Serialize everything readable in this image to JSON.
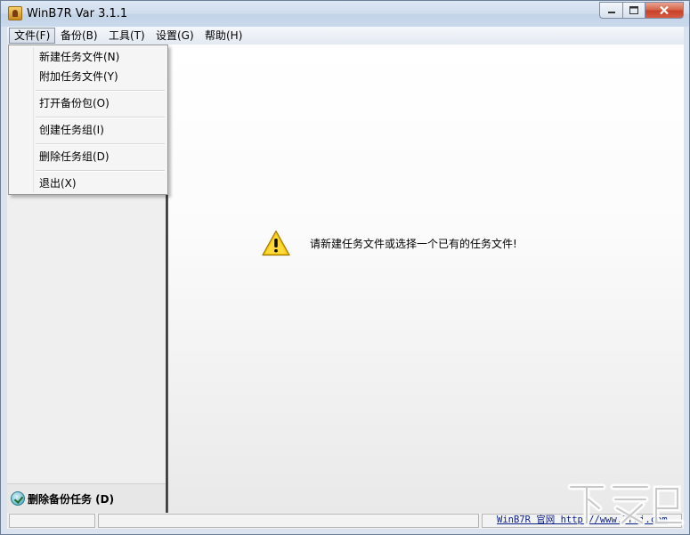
{
  "window": {
    "title": "WinB7R Var 3.1.1"
  },
  "menu": [
    {
      "label": "文件(F)"
    },
    {
      "label": "备份(B)"
    },
    {
      "label": "工具(T)"
    },
    {
      "label": "设置(G)"
    },
    {
      "label": "帮助(H)"
    }
  ],
  "file_menu": {
    "items": [
      {
        "label": "新建任务文件(N)"
      },
      {
        "label": "附加任务文件(Y)"
      },
      {
        "label": "打开备份包(O)"
      },
      {
        "label": "创建任务组(I)"
      },
      {
        "label": "删除任务组(D)"
      },
      {
        "label": "退出(X)"
      }
    ]
  },
  "left_pane": {
    "delete_task_label": "删除备份任务 (D)"
  },
  "main": {
    "message": "请新建任务文件或选择一个已有的任务文件!"
  },
  "status": {
    "link_text": "WinB7R 官网 http://www.7rki.com"
  },
  "watermark": {
    "text": "下载吧"
  },
  "colors": {
    "warning": "#f5c400",
    "link": "#0a1f88",
    "close_button": "#c8402a"
  }
}
